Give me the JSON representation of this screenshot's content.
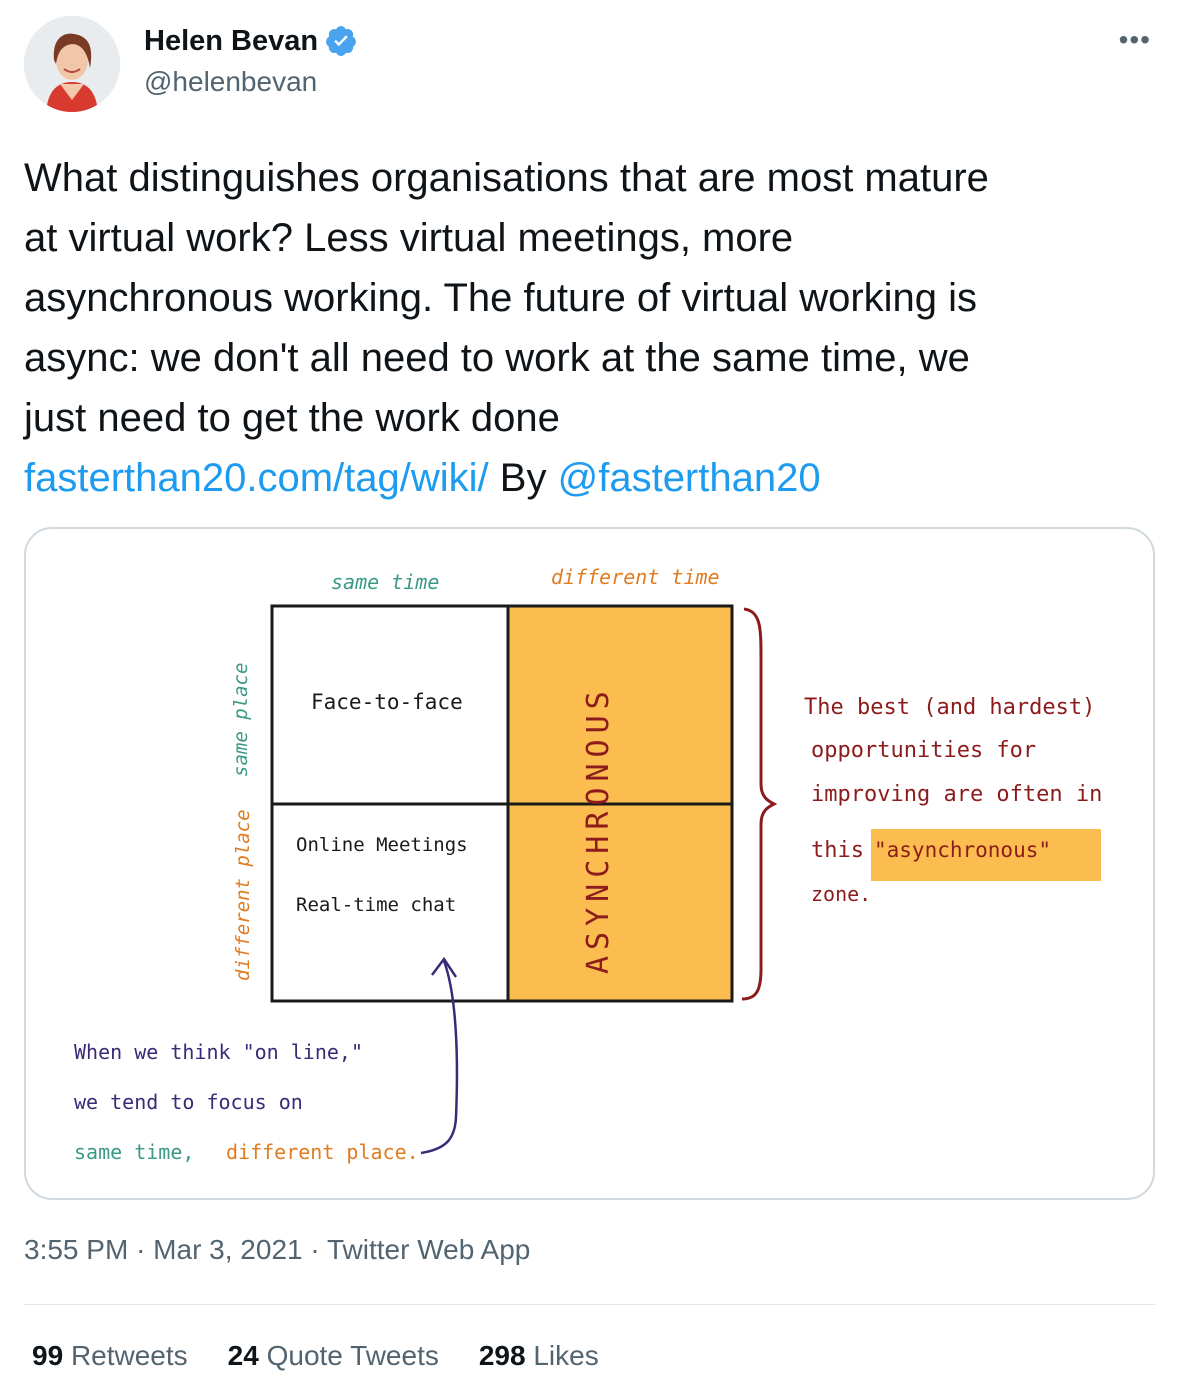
{
  "user": {
    "name": "Helen Bevan",
    "handle": "@helenbevan",
    "verified_color": "#1d9bf0"
  },
  "menu_label": "•••",
  "tweet": {
    "lines": [
      "What distinguishes organisations that are most mature",
      "at virtual work? Less virtual meetings, more",
      "asynchronous working. The future of virtual working is",
      "async: we don't all need to work at the same time, we",
      "just need to get the work done"
    ],
    "link_text": "fasterthan20.com/tag/wiki/",
    "by_text": "By",
    "mention": "@fasterthan20",
    "link_color": "#1d9bf0"
  },
  "image": {
    "col_same_time": "same time",
    "col_different_time": "different time",
    "row_same_place": "same place",
    "row_different_place": "different place",
    "cell_face": "Face-to-face",
    "cell_online": "Online Meetings",
    "cell_chat": "Real-time chat",
    "async_label": "ASYNCHRONOUS",
    "async_color": "#fbbd4f",
    "note_lines": [
      "The best (and hardest)",
      "opportunities for",
      "improving are often in",
      "this",
      "\"asynchronous\"",
      "zone."
    ],
    "bottom_lines": [
      "When we think \"on line,\"",
      "we tend to focus on",
      "same time,",
      "different place."
    ],
    "green": "#3a9a86",
    "orange": "#e07b1f",
    "red": "#8c1c1c",
    "purple": "#3b2a78"
  },
  "meta": {
    "time": "3:55 PM",
    "sep": "·",
    "date": "Mar 3, 2021",
    "source": "Twitter Web App"
  },
  "stats": {
    "retweets_count": "99",
    "retweets_label": "Retweets",
    "quotes_count": "24",
    "quotes_label": "Quote Tweets",
    "likes_count": "298",
    "likes_label": "Likes"
  }
}
